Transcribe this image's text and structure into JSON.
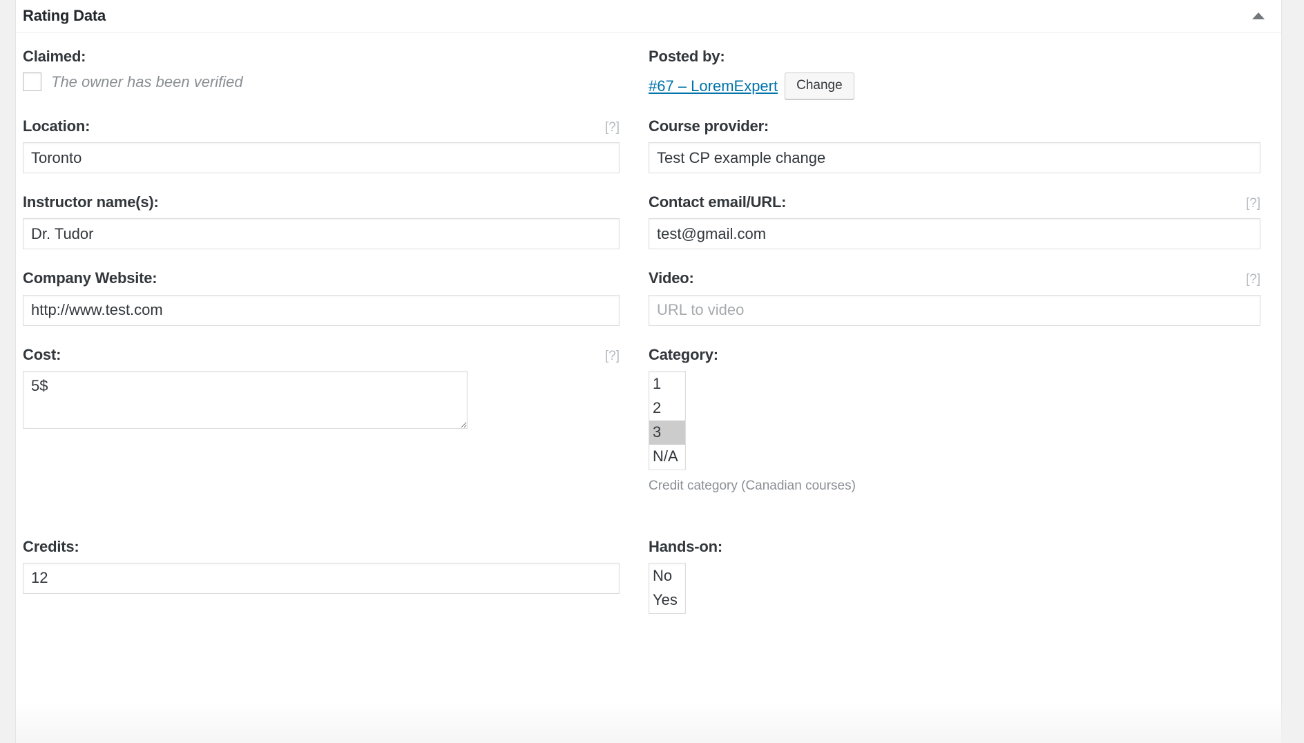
{
  "panel": {
    "title": "Rating Data",
    "toggle_icon": "caret-up-icon",
    "toggle_title": "Toggle panel: Rating Data"
  },
  "fields": {
    "claimed": {
      "label": "Claimed:",
      "checkbox_label": "The owner has been verified",
      "checked": false
    },
    "posted_by": {
      "label": "Posted by:",
      "link_text": "#67 – LoremExpert",
      "change_button": "Change"
    },
    "location": {
      "label": "Location:",
      "help": "[?]",
      "value": "Toronto",
      "placeholder": ""
    },
    "course_provider": {
      "label": "Course provider:",
      "value": "Test CP example change",
      "placeholder": ""
    },
    "instructor": {
      "label": "Instructor name(s):",
      "value": "Dr. Tudor",
      "placeholder": ""
    },
    "contact": {
      "label": "Contact email/URL:",
      "help": "[?]",
      "value": "test@gmail.com",
      "placeholder": ""
    },
    "company_website": {
      "label": "Company Website:",
      "value": "http://www.test.com",
      "placeholder": ""
    },
    "video": {
      "label": "Video:",
      "help": "[?]",
      "value": "",
      "placeholder": "URL to video"
    },
    "cost": {
      "label": "Cost:",
      "help": "[?]",
      "value": "5$"
    },
    "category": {
      "label": "Category:",
      "options": [
        "1",
        "2",
        "3",
        "N/A"
      ],
      "selected": "3",
      "helper": "Credit category (Canadian courses)"
    },
    "credits": {
      "label": "Credits:",
      "value": "12",
      "placeholder": ""
    },
    "hands_on": {
      "label": "Hands-on:",
      "options": [
        "No",
        "Yes"
      ],
      "selected": ""
    }
  },
  "colors": {
    "link": "#0073aa",
    "label": "#32373c",
    "muted": "#8a8f94",
    "border": "#dddddd",
    "page_bg": "#f1f1f1"
  }
}
